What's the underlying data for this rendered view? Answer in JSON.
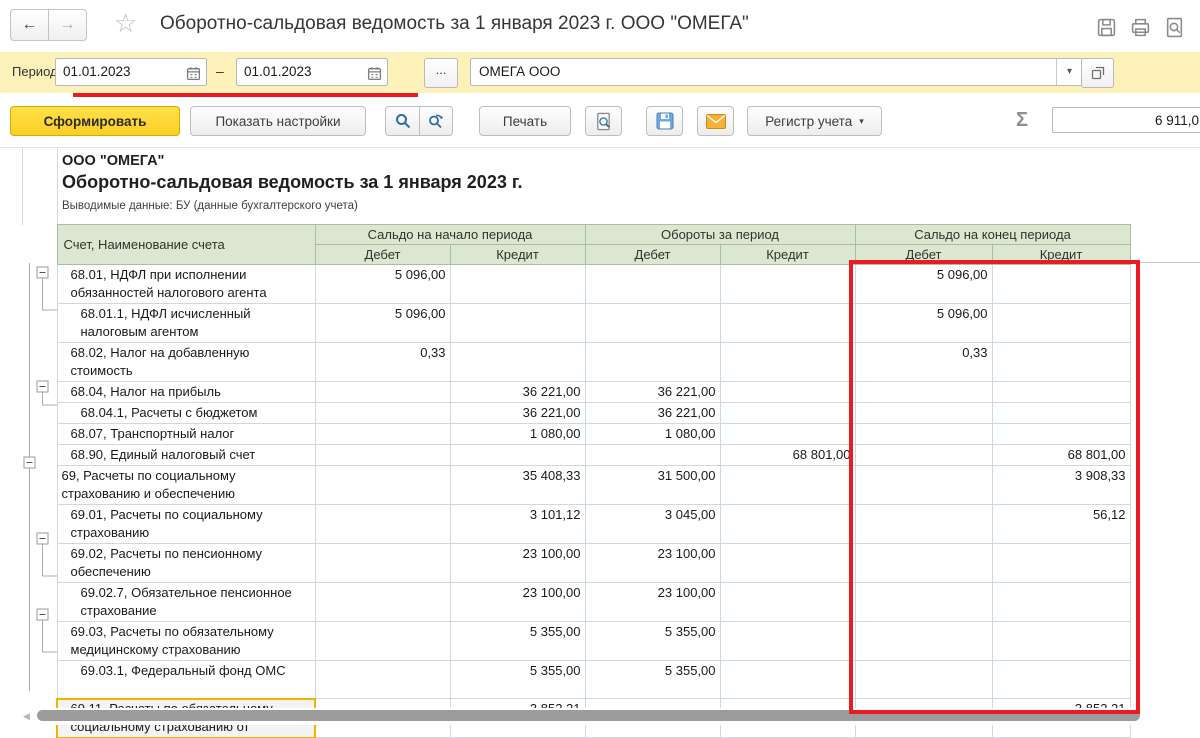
{
  "window": {
    "title": "Оборотно-сальдовая ведомость за 1 января 2023 г. ООО \"ОМЕГА\"",
    "back_arrow": "←",
    "forward_arrow": "→",
    "favorite_star": "☆"
  },
  "period_bar": {
    "label": "Период:",
    "date_from": "01.01.2023",
    "date_to": "01.01.2023",
    "dash": "–",
    "more_button": "...",
    "organization": "ОМЕГА ООО",
    "dropdown_arrow": "▾"
  },
  "toolbar": {
    "generate": "Сформировать",
    "settings": "Показать настройки",
    "print": "Печать",
    "register": "Регистр учета",
    "register_arrow": "▾",
    "sigma": "Σ",
    "sum_value": "6 911,0"
  },
  "report": {
    "org": "ООО \"ОМЕГА\"",
    "title": "Оборотно-сальдовая ведомость за 1 января 2023 г.",
    "subtitle": "Выводимые данные: БУ (данные бухгалтерского учета)"
  },
  "table": {
    "account_header": "Счет, Наименование счета",
    "groups": [
      "Сальдо на начало периода",
      "Обороты за период",
      "Сальдо на конец периода"
    ],
    "sub_headers": [
      "Дебет",
      "Кредит"
    ],
    "rows": [
      {
        "name": "68.01, НДФЛ при исполнении обязанностей налогового агента",
        "indent": 1,
        "group": true,
        "selected": false,
        "values": [
          "5 096,00",
          "",
          "",
          "",
          "5 096,00",
          ""
        ]
      },
      {
        "name": "68.01.1, НДФЛ исчисленный налоговым агентом",
        "indent": 2,
        "group": false,
        "selected": false,
        "values": [
          "5 096,00",
          "",
          "",
          "",
          "5 096,00",
          ""
        ]
      },
      {
        "name": "68.02, Налог на добавленную стоимость",
        "indent": 1,
        "group": false,
        "selected": false,
        "values": [
          "0,33",
          "",
          "",
          "",
          "0,33",
          ""
        ]
      },
      {
        "name": "68.04, Налог на прибыль",
        "indent": 1,
        "group": true,
        "selected": false,
        "values": [
          "",
          "36 221,00",
          "36 221,00",
          "",
          "",
          ""
        ]
      },
      {
        "name": "68.04.1, Расчеты с бюджетом",
        "indent": 2,
        "group": false,
        "selected": false,
        "values": [
          "",
          "36 221,00",
          "36 221,00",
          "",
          "",
          ""
        ]
      },
      {
        "name": "68.07, Транспортный налог",
        "indent": 1,
        "group": false,
        "selected": false,
        "values": [
          "",
          "1 080,00",
          "1 080,00",
          "",
          "",
          ""
        ]
      },
      {
        "name": "68.90, Единый налоговый счет",
        "indent": 1,
        "group": false,
        "selected": false,
        "values": [
          "",
          "",
          "",
          "68 801,00",
          "",
          "68 801,00"
        ]
      },
      {
        "name": "69, Расчеты по социальному страхованию и обеспечению",
        "indent": 0,
        "group": true,
        "selected": false,
        "values": [
          "",
          "35 408,33",
          "31 500,00",
          "",
          "",
          "3 908,33"
        ]
      },
      {
        "name": "69.01, Расчеты по социальному страхованию",
        "indent": 1,
        "group": false,
        "selected": false,
        "values": [
          "",
          "3 101,12",
          "3 045,00",
          "",
          "",
          "56,12"
        ]
      },
      {
        "name": "69.02, Расчеты по пенсионному обеспечению",
        "indent": 1,
        "group": true,
        "selected": false,
        "values": [
          "",
          "23 100,00",
          "23 100,00",
          "",
          "",
          ""
        ]
      },
      {
        "name": "69.02.7, Обязательное пенсионное страхование",
        "indent": 2,
        "group": false,
        "selected": false,
        "values": [
          "",
          "23 100,00",
          "23 100,00",
          "",
          "",
          ""
        ]
      },
      {
        "name": "69.03, Расчеты по обязательному медицинскому страхованию",
        "indent": 1,
        "group": true,
        "selected": false,
        "values": [
          "",
          "5 355,00",
          "5 355,00",
          "",
          "",
          ""
        ]
      },
      {
        "name": "69.03.1, Федеральный фонд ОМС",
        "indent": 2,
        "group": false,
        "selected": false,
        "values": [
          "",
          "5 355,00",
          "5 355,00",
          "",
          "",
          ""
        ]
      },
      {
        "name": "69.11, Расчеты по обязательному социальному страхованию от",
        "indent": 1,
        "group": false,
        "selected": true,
        "values": [
          "",
          "3 852,21",
          "",
          "",
          "",
          "3 852,21"
        ]
      }
    ]
  },
  "colors": {
    "accent_yellow_bar": "#fdf1ba",
    "generate_button_yellow": "#ffd42b",
    "annotation_red": "#ea1b22",
    "header_green": "#dbe7d1",
    "selection_yellow": "#efb300"
  }
}
